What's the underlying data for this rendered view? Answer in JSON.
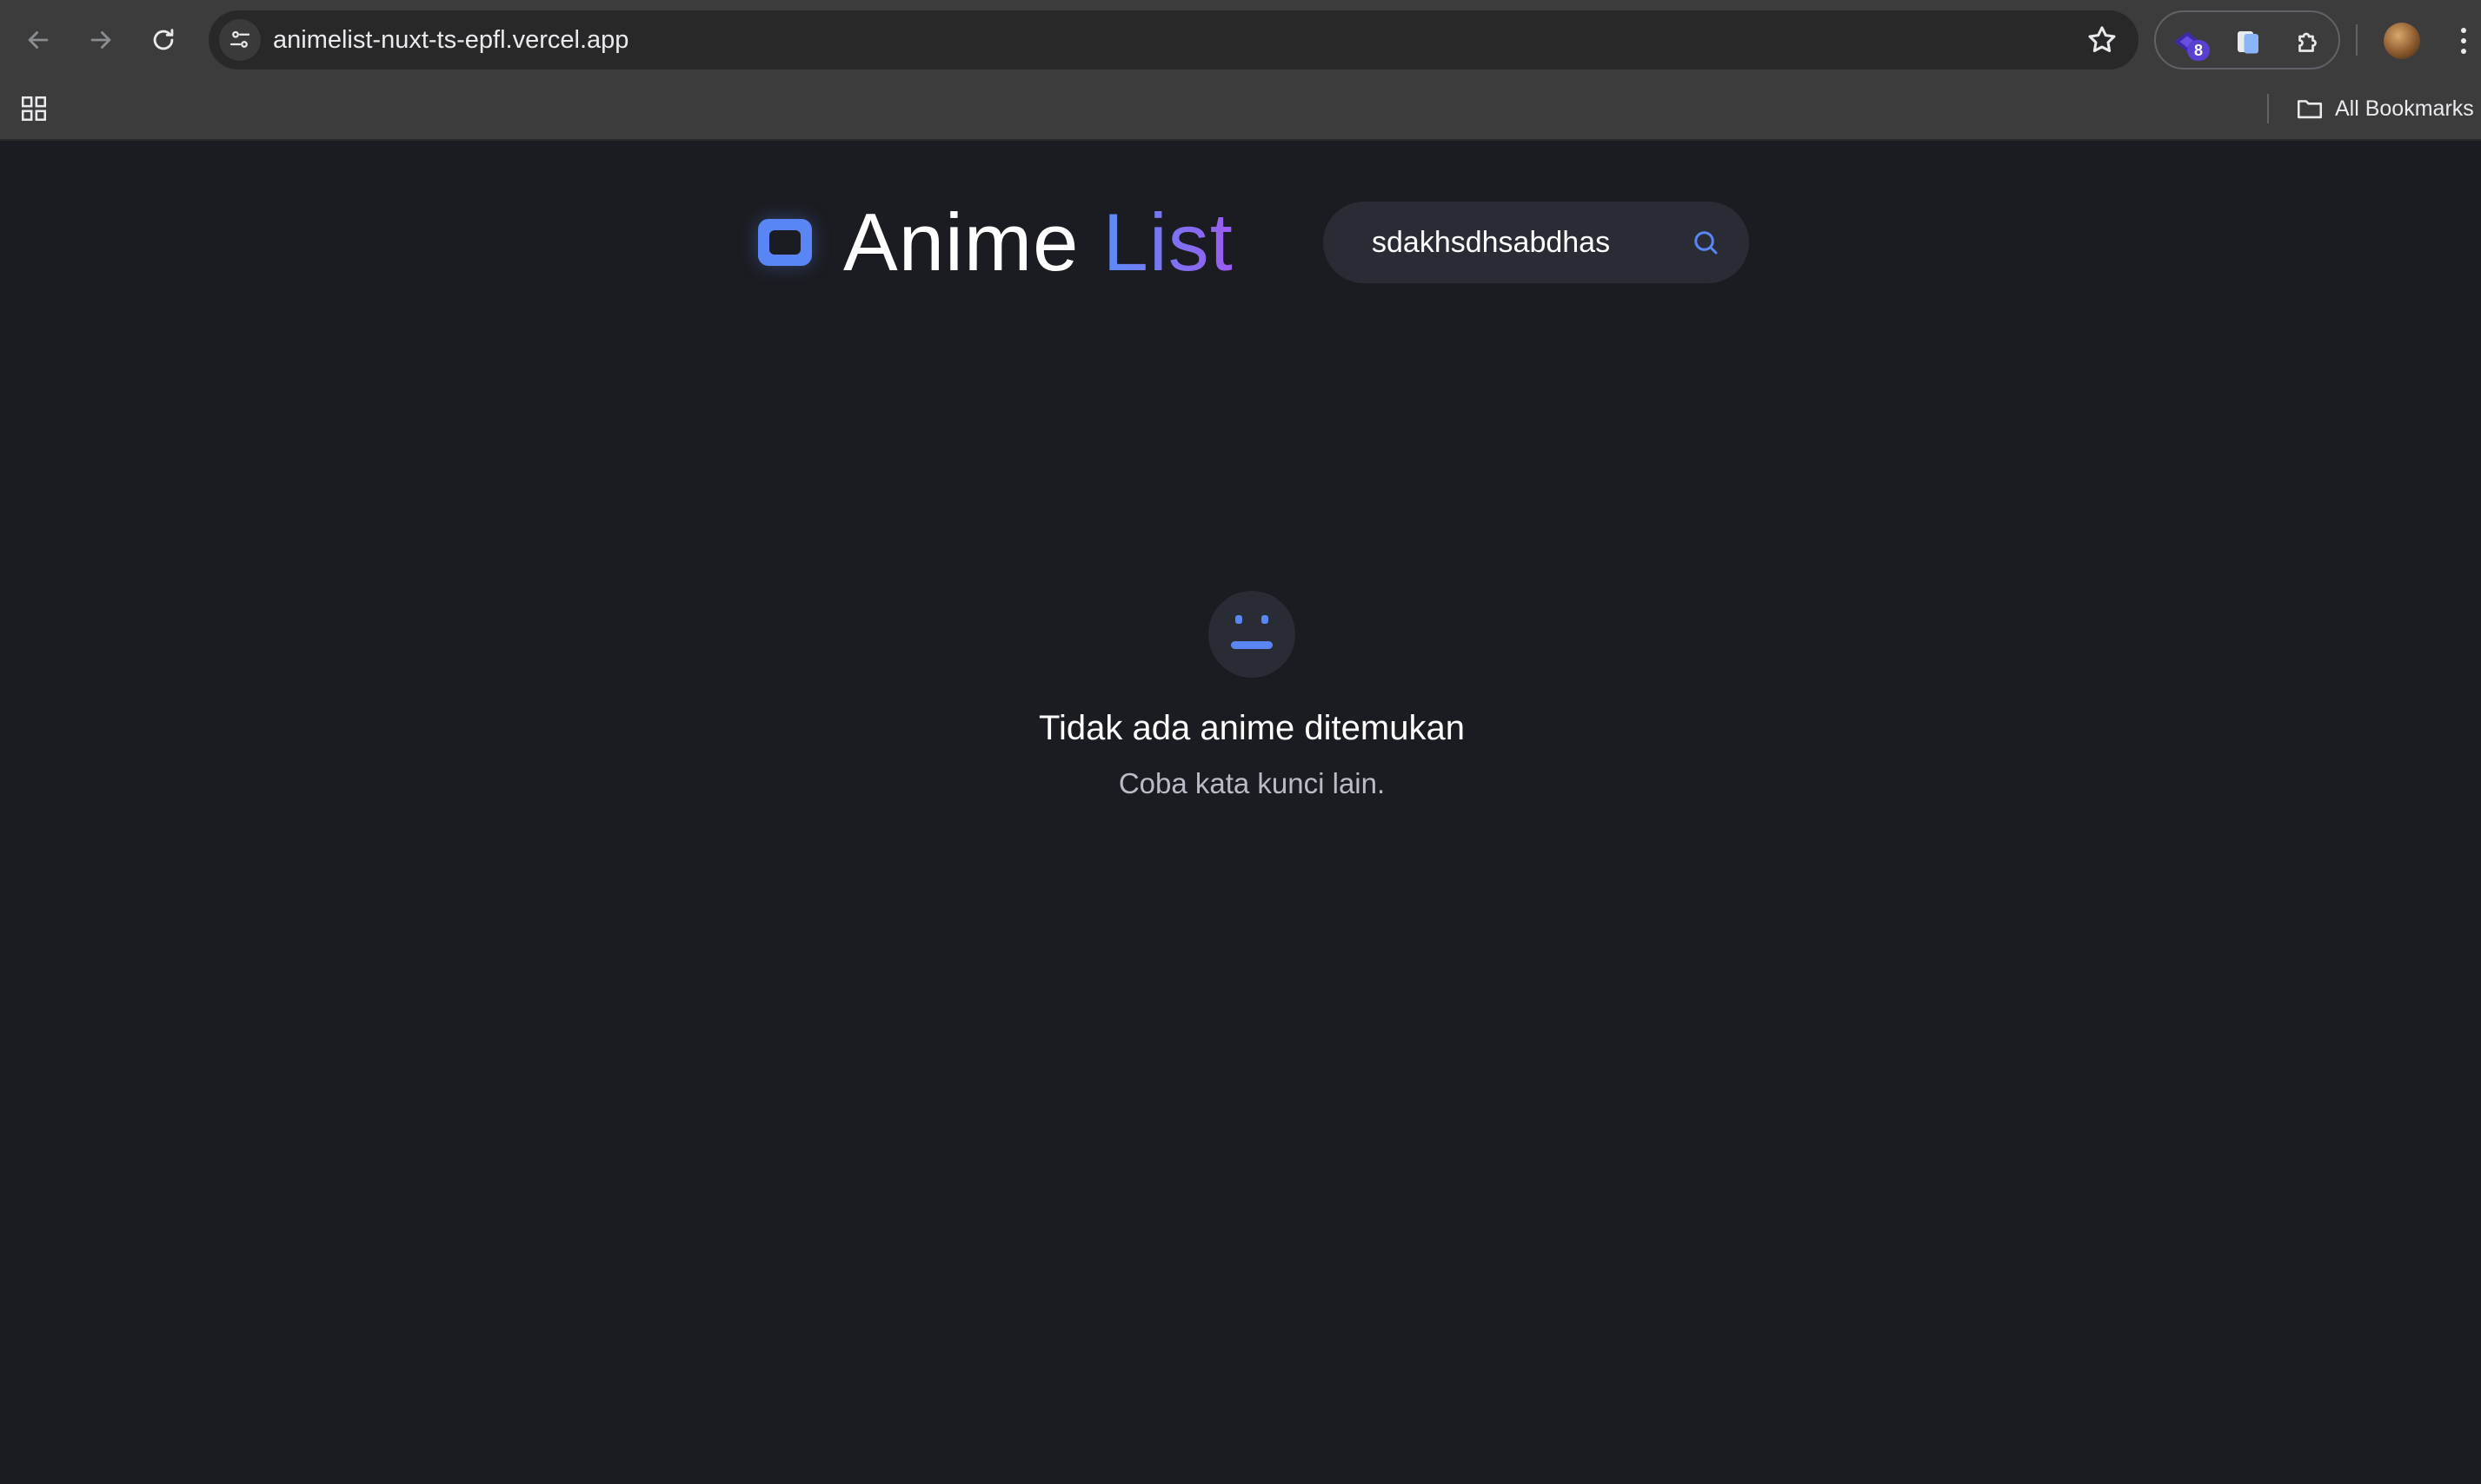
{
  "browser": {
    "url": "animelist-nuxt-ts-epfl.vercel.app",
    "extension_badge": "8",
    "bookmarks_label": "All Bookmarks"
  },
  "header": {
    "brand_word1": "Anime",
    "brand_word2": "List",
    "brand_gradient": [
      "#5b8cf6",
      "#9a5cf0"
    ],
    "search_value": "sdakhsdhsabdhas",
    "search_placeholder": ""
  },
  "empty_state": {
    "title": "Tidak ada anime ditemukan",
    "subtitle": "Coba kata kunci lain."
  },
  "colors": {
    "background": "#1b1c21",
    "accent": "#5a86f5",
    "surface": "#2a2c35"
  },
  "icons": {
    "back": "arrow-left-icon",
    "forward": "arrow-right-icon",
    "reload": "reload-icon",
    "site_info": "tune-icon",
    "bookmark": "star-icon",
    "search": "search-icon",
    "empty": "neutral-face-icon"
  }
}
